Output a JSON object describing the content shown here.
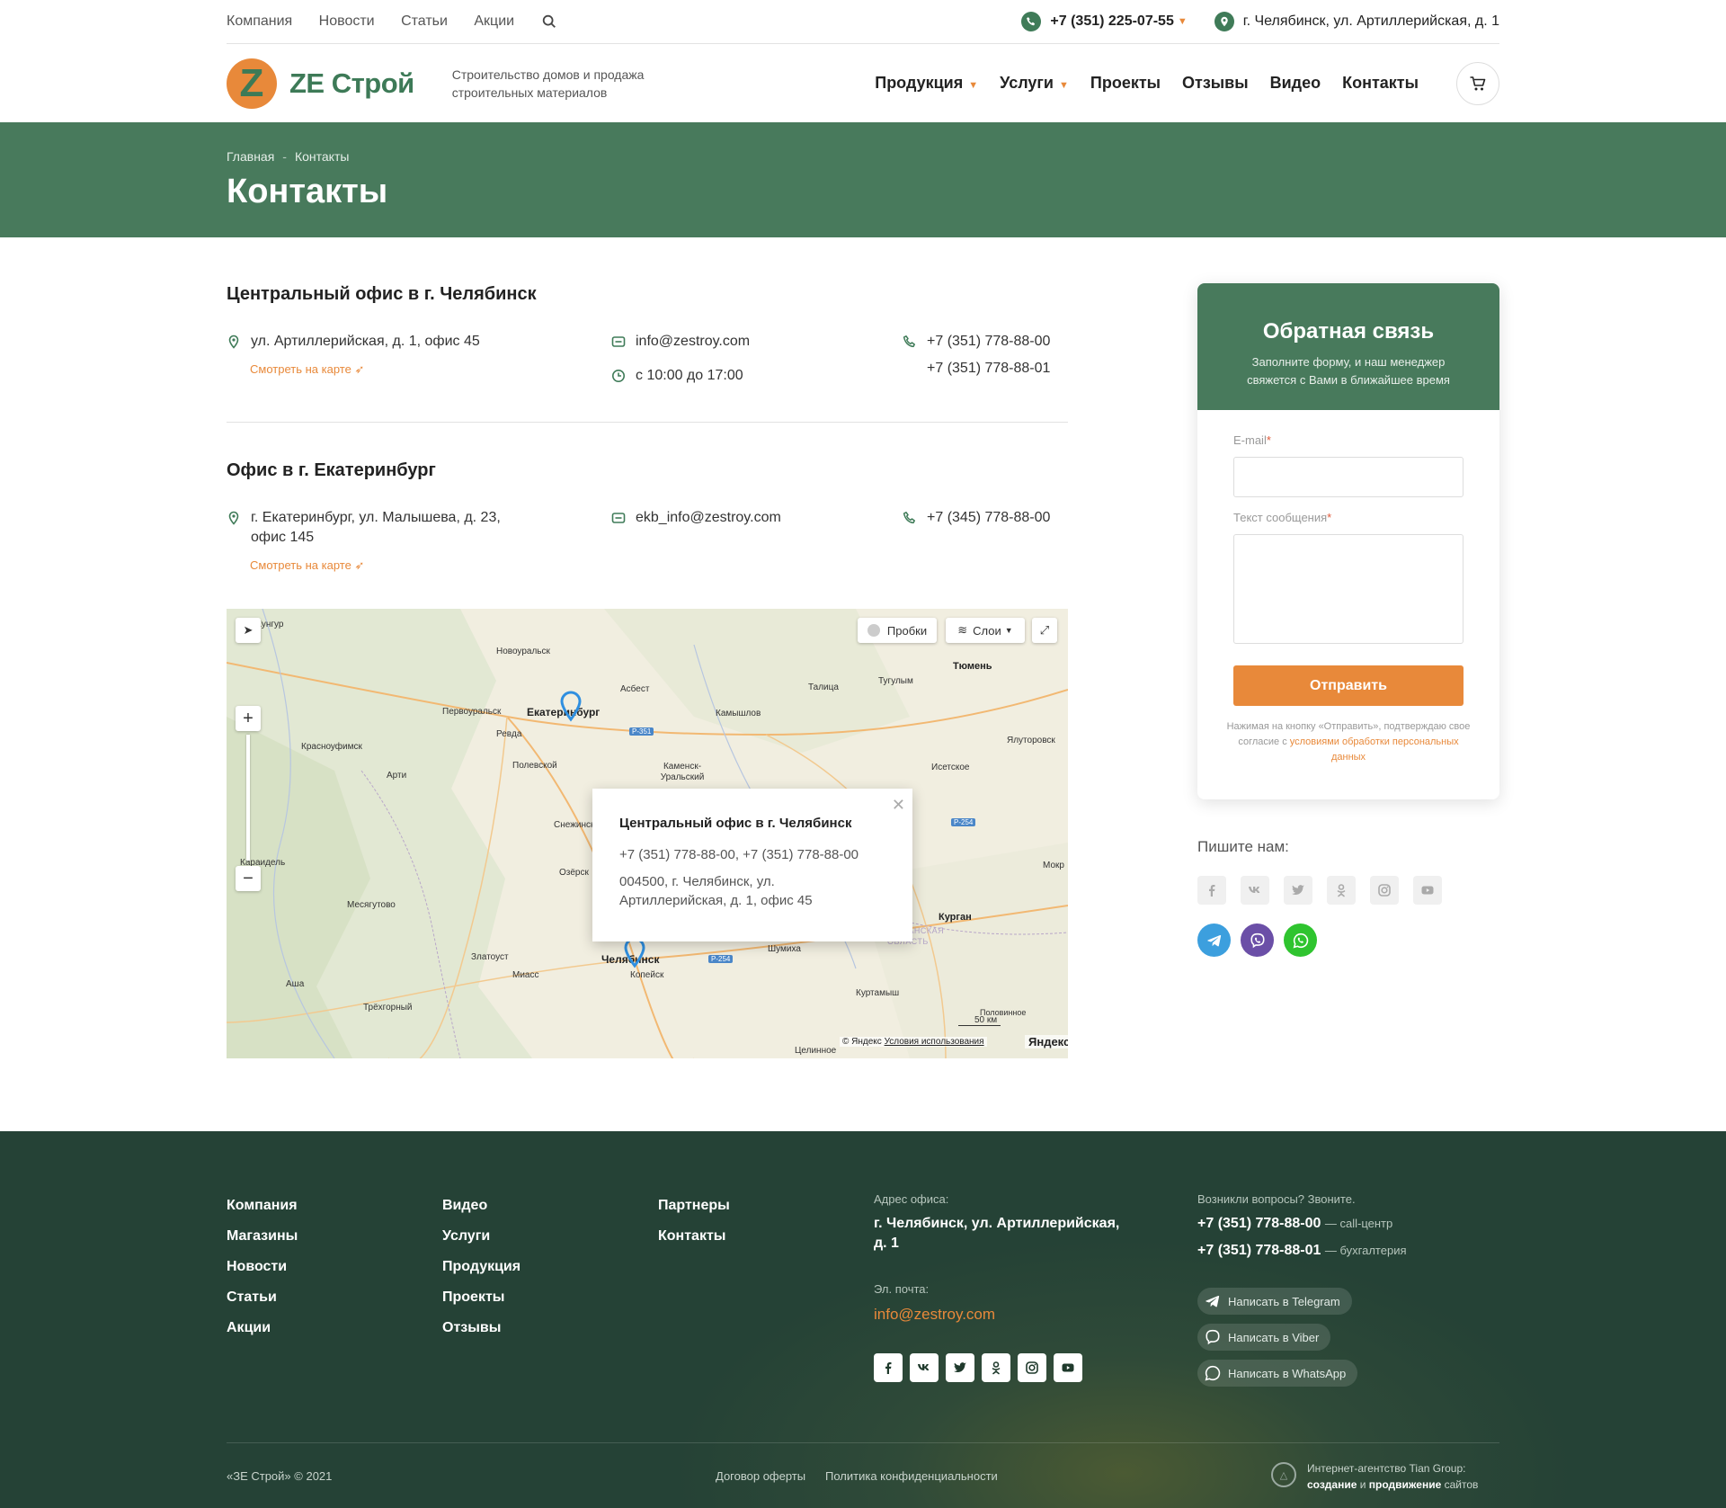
{
  "topbar": {
    "nav": [
      "Компания",
      "Новости",
      "Статьи",
      "Акции"
    ],
    "phone": "+7 (351) 225-07-55",
    "address": "г. Челябинск, ул. Артиллерийская, д. 1"
  },
  "header": {
    "logo_letter": "Z",
    "logo_text": "ZE Строй",
    "tagline": "Строительство домов и продажа строительных материалов",
    "nav": [
      {
        "label": "Продукция",
        "dropdown": true
      },
      {
        "label": "Услуги",
        "dropdown": true
      },
      {
        "label": "Проекты"
      },
      {
        "label": "Отзывы"
      },
      {
        "label": "Видео"
      },
      {
        "label": "Контакты"
      }
    ]
  },
  "banner": {
    "breadcrumbs": [
      "Главная",
      "Контакты"
    ],
    "title": "Контакты"
  },
  "offices": [
    {
      "title": "Центральный офис в г. Челябинск",
      "address": "ул. Артиллерийская, д. 1, офис 45",
      "map_link": "Смотреть на карте",
      "email": "info@zestroy.com",
      "hours": "с 10:00 до 17:00",
      "phones": [
        "+7 (351) 778-88-00",
        "+7 (351) 778-88-01"
      ]
    },
    {
      "title": "Офис в г. Екатеринбург",
      "address_line1": "г. Екатеринбург, ул. Малышева, д. 23,",
      "address_line2": "офис 145",
      "map_link": "Смотреть на карте",
      "email": "ekb_info@zestroy.com",
      "phones": [
        "+7 (345) 778-88-00"
      ]
    }
  ],
  "map": {
    "traffic": "Пробки",
    "layers": "Слои",
    "scale": "50 км",
    "copyright": "© Яндекс",
    "terms": "Условия использования",
    "brand": "Яндекс",
    "popup": {
      "title": "Центральный офис в г. Челябинск",
      "phones": "+7 (351) 778-88-00, +7 (351) 778-88-00",
      "address_line1": "004500, г. Челябинск, ул.",
      "address_line2": "Артиллерийская, д. 1, офис 45"
    },
    "cities": [
      {
        "name": "Кунгур"
      },
      {
        "name": "Новоуральск"
      },
      {
        "name": "Первоуральск"
      },
      {
        "name": "Екатеринбург"
      },
      {
        "name": "Асбест"
      },
      {
        "name": "Талица"
      },
      {
        "name": "Тугулым"
      },
      {
        "name": "Тюмень"
      },
      {
        "name": "Ревда"
      },
      {
        "name": "Камышлов"
      },
      {
        "name": "Красноуфимск"
      },
      {
        "name": "Полевской"
      },
      {
        "name": "Каменск-Уральский"
      },
      {
        "name": "Арти"
      },
      {
        "name": "Исетское"
      },
      {
        "name": "Ялуторовск"
      },
      {
        "name": "Снежинск"
      },
      {
        "name": "Караидель"
      },
      {
        "name": "Озёрск"
      },
      {
        "name": "Месягутово"
      },
      {
        "name": "Курган"
      },
      {
        "name": "Златоуст"
      },
      {
        "name": "Миасс"
      },
      {
        "name": "Челябинск"
      },
      {
        "name": "Копейск"
      },
      {
        "name": "Шумиха"
      },
      {
        "name": "Куртамыш"
      },
      {
        "name": "Аша"
      },
      {
        "name": "Трёхгорный"
      },
      {
        "name": "Целинное"
      },
      {
        "name": "Мокр"
      },
      {
        "name": "Половинное"
      }
    ],
    "road_labels": [
      "Р-351",
      "Р-254",
      "Р-254"
    ],
    "region_label": "КУРГАНСКАЯ ОБЛАСТЬ"
  },
  "form": {
    "title": "Обратная связь",
    "subtitle": "Заполните форму, и наш менеджер свяжется с Вами в ближайшее время",
    "email_label": "E-mail",
    "message_label": "Текст сообщения",
    "required_mark": "*",
    "submit": "Отправить",
    "note_prefix": "Нажимая на кнопку «Отправить», подтверждаю свое согласие с ",
    "note_link": "условиями обработки персональных данных"
  },
  "write_us": {
    "title": "Пишите нам:",
    "socials": [
      "facebook-icon",
      "vk-icon",
      "twitter-icon",
      "odnoklassniki-icon",
      "instagram-icon",
      "youtube-icon"
    ],
    "messengers": [
      {
        "icon": "telegram-icon",
        "color": "#3c9fde"
      },
      {
        "icon": "viber-icon",
        "color": "#6b4fa7"
      },
      {
        "icon": "whatsapp-icon",
        "color": "#2fc42f"
      }
    ]
  },
  "footer": {
    "col1": [
      "Компания",
      "Магазины",
      "Новости",
      "Статьи",
      "Акции"
    ],
    "col2": [
      "Видео",
      "Услуги",
      "Продукция",
      "Проекты",
      "Отзывы"
    ],
    "col3": [
      "Партнеры",
      "Контакты"
    ],
    "address_label": "Адрес офиса:",
    "address_line1": "г. Челябинск, ул. Артиллерийская,",
    "address_line2": "д. 1",
    "email_label": "Эл. почта:",
    "email": "info@zestroy.com",
    "questions_label": "Возникли вопросы? Звоните.",
    "phone1": "+7 (351) 778-88-00",
    "phone1_note": "— call-центр",
    "phone2": "+7 (351) 778-88-01",
    "phone2_note": "— бухгалтерия",
    "messengers": [
      "Написать в Telegram",
      "Написать в Viber",
      "Написать в WhatsApp"
    ],
    "copyright": "«ЗЕ Строй» © 2021",
    "links": [
      "Договор оферты",
      "Политика конфиденциальности"
    ],
    "agency_line1": "Интернет-агентство Tian Group:",
    "agency_bold1": "создание",
    "agency_and": "и",
    "agency_bold2": "продвижение",
    "agency_tail": "сайтов"
  },
  "colors": {
    "green": "#487a5c",
    "dark_green": "#2f4a38",
    "orange": "#e8893a"
  }
}
